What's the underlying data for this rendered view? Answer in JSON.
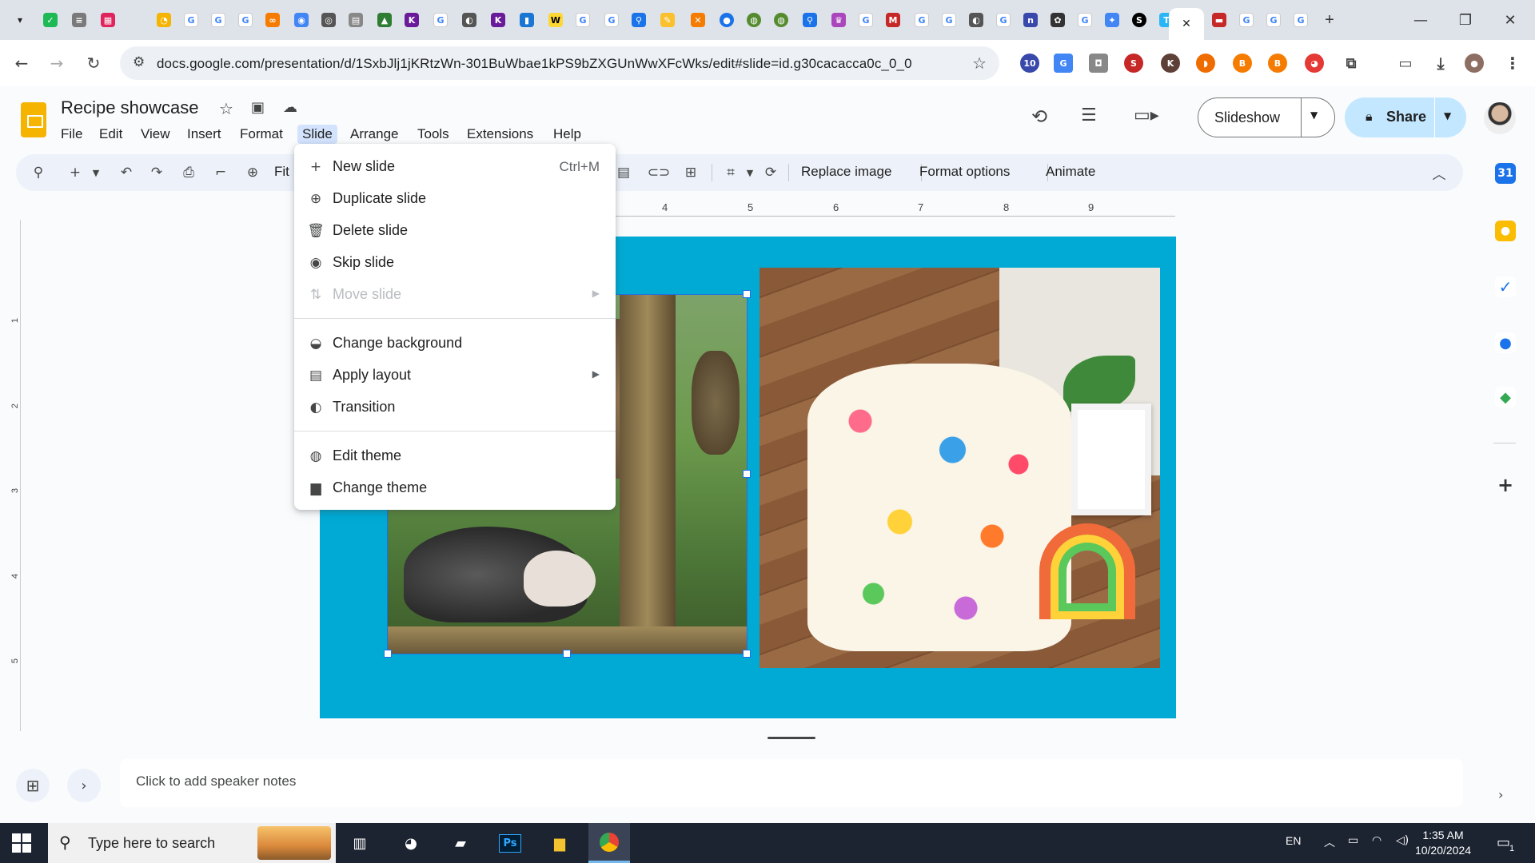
{
  "browser": {
    "url": "docs.google.com/presentation/d/1SxbJlj1jKRtzWn-301BuWbae1kPS9bZXGUnWwXFcWks/edit#slide=id.g30cacacca0c_0_0",
    "active_tab_close": "✕",
    "new_tab": "+",
    "window": {
      "minimize": "—",
      "maximize": "❐",
      "close": "✕"
    }
  },
  "doc": {
    "title": "Recipe showcase",
    "menus": [
      "File",
      "Edit",
      "View",
      "Insert",
      "Format",
      "Slide",
      "Arrange",
      "Tools",
      "Extensions",
      "Help"
    ],
    "open_menu": "Slide"
  },
  "header_buttons": {
    "slideshow": "Slideshow",
    "share": "Share"
  },
  "toolbar": {
    "zoom_label": "Fit",
    "replace_image": "Replace image",
    "format_options": "Format options",
    "animate": "Animate"
  },
  "ruler": {
    "h_ticks": [
      "4",
      "5",
      "6",
      "7",
      "8",
      "9"
    ],
    "v_ticks": [
      "1",
      "2",
      "3",
      "4",
      "5"
    ]
  },
  "slide_menu": {
    "items": [
      {
        "label": "New slide",
        "shortcut": "Ctrl+M",
        "icon": "plus-icon",
        "disabled": false
      },
      {
        "label": "Duplicate slide",
        "shortcut": "",
        "icon": "duplicate-icon",
        "disabled": false
      },
      {
        "label": "Delete slide",
        "shortcut": "",
        "icon": "trash-icon",
        "disabled": false
      },
      {
        "label": "Skip slide",
        "shortcut": "",
        "icon": "eye-icon",
        "disabled": false
      },
      {
        "label": "Move slide",
        "shortcut": "",
        "icon": "move-icon",
        "disabled": true,
        "submenu": true
      },
      {
        "label": "Change background",
        "shortcut": "",
        "icon": "fill-icon",
        "disabled": false
      },
      {
        "label": "Apply layout",
        "shortcut": "",
        "icon": "layout-icon",
        "disabled": false,
        "submenu": true
      },
      {
        "label": "Transition",
        "shortcut": "",
        "icon": "transition-icon",
        "disabled": false
      },
      {
        "label": "Edit theme",
        "shortcut": "",
        "icon": "palette-icon",
        "disabled": false
      },
      {
        "label": "Change theme",
        "shortcut": "",
        "icon": "paint-roller-icon",
        "disabled": false
      }
    ]
  },
  "notes": {
    "placeholder": "Click to add speaker notes"
  },
  "taskbar": {
    "search_placeholder": "Type here to search",
    "language": "EN",
    "time": "1:35 AM",
    "date": "10/20/2024",
    "notification_count": "1"
  },
  "colors": {
    "slide_background": "#00aad4",
    "selection": "#1a73e8",
    "menu_highlight": "#d3e3fd",
    "share_button": "#c2e7ff",
    "slides_logo": "#f4b400"
  }
}
